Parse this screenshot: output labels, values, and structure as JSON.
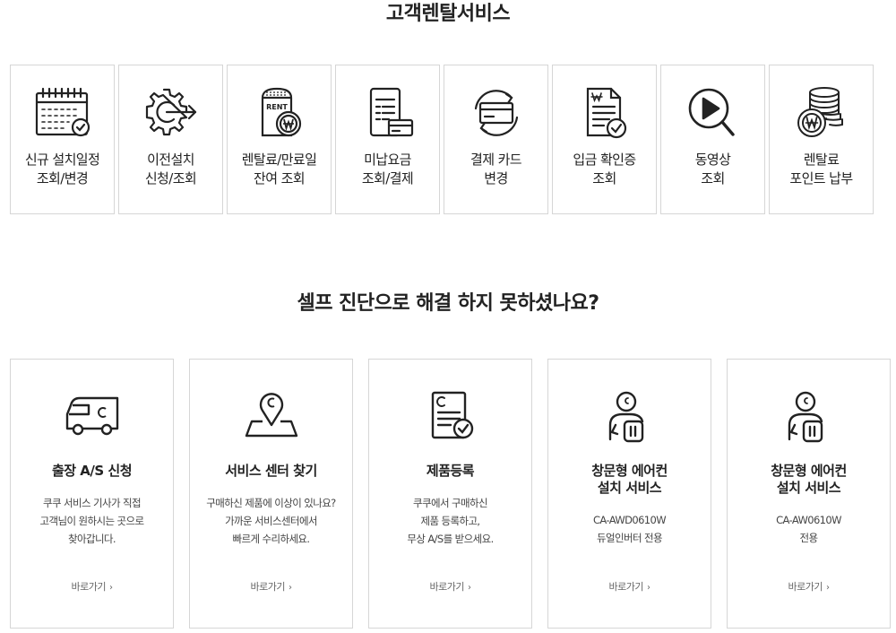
{
  "rental_section": {
    "title": "고객렌탈서비스"
  },
  "services": [
    {
      "icon": "calendar-check-icon",
      "label": "신규 설치일정\n조회/변경"
    },
    {
      "icon": "gear-arrow-icon",
      "label": "이전설치\n신청/조회"
    },
    {
      "icon": "rent-product-won-icon",
      "label": "렌탈료/만료일\n잔여 조회"
    },
    {
      "icon": "bill-card-icon",
      "label": "미납요금\n조회/결제"
    },
    {
      "icon": "card-refresh-icon",
      "label": "결제 카드\n변경"
    },
    {
      "icon": "receipt-check-icon",
      "label": "입금 확인증\n조회"
    },
    {
      "icon": "video-search-icon",
      "label": "동영상\n조회"
    },
    {
      "icon": "coins-won-icon",
      "label": "렌탈료\n포인트 납부"
    }
  ],
  "self_section": {
    "title": "셀프 진단으로 해결 하지 못하셨나요?"
  },
  "cards": [
    {
      "icon": "van-icon",
      "title": "출장 A/S 신청",
      "desc": "쿠쿠 서비스 기사가 직접\n고객님이 원하시는 곳으로\n찾아갑니다.",
      "link": "바로가기"
    },
    {
      "icon": "map-pin-icon",
      "title": "서비스 센터 찾기",
      "desc": "구매하신 제품에 이상이 있나요?\n가까운 서비스센터에서\n빠르게 수리하세요.",
      "link": "바로가기"
    },
    {
      "icon": "document-check-icon",
      "title": "제품등록",
      "desc": "쿠쿠에서 구매하신\n제품 등록하고,\n무상 A/S를 받으세요.",
      "link": "바로가기"
    },
    {
      "icon": "technician-icon",
      "title": "창문형 에어컨\n설치 서비스",
      "desc": "CA-AWD0610W\n듀얼인버터 전용",
      "link": "바로가기"
    },
    {
      "icon": "technician-icon",
      "title": "창문형 에어컨\n설치 서비스",
      "desc": "CA-AW0610W\n전용",
      "link": "바로가기"
    }
  ],
  "link_chevron": "›"
}
